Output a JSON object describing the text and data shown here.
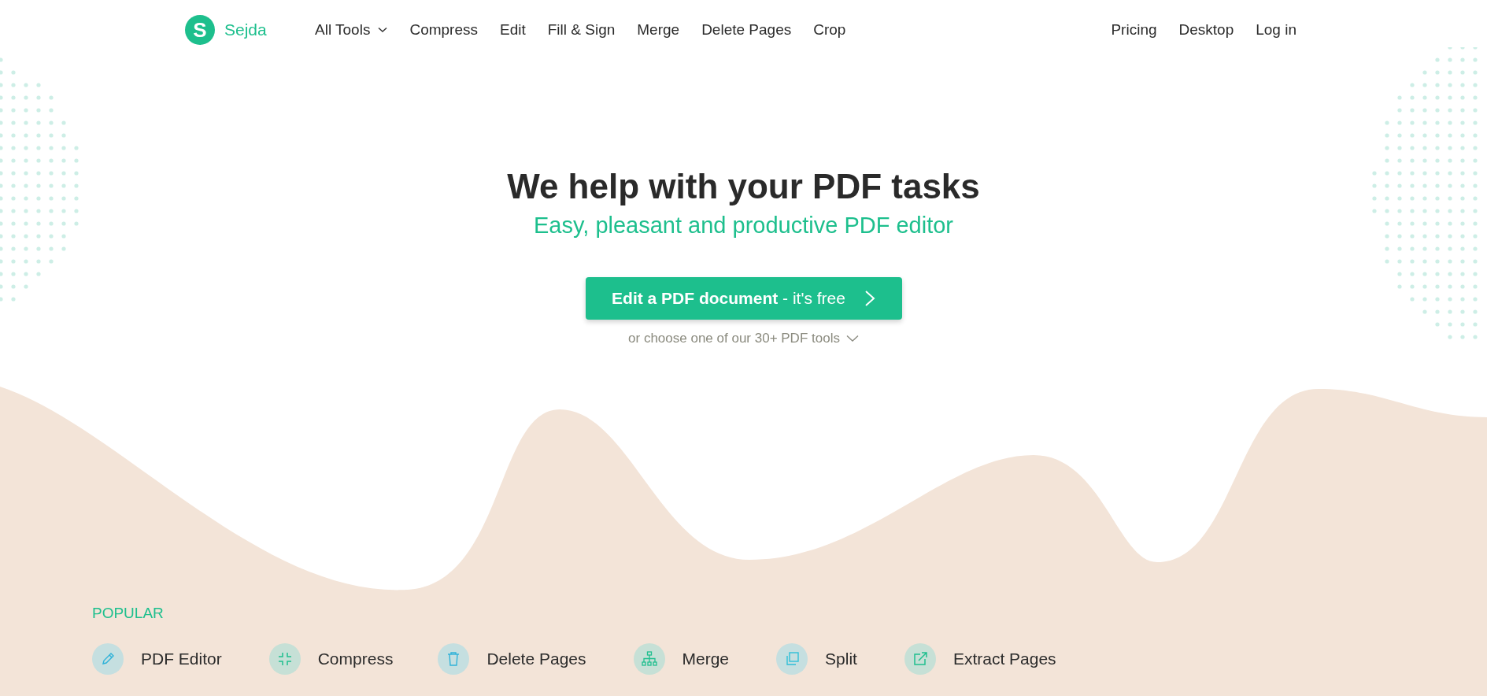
{
  "brand": {
    "logo_letter": "S",
    "name": "Sejda"
  },
  "nav": [
    {
      "label": "All Tools",
      "dropdown": true
    },
    {
      "label": "Compress",
      "dropdown": false
    },
    {
      "label": "Edit",
      "dropdown": false
    },
    {
      "label": "Fill & Sign",
      "dropdown": false
    },
    {
      "label": "Merge",
      "dropdown": false
    },
    {
      "label": "Delete Pages",
      "dropdown": false
    },
    {
      "label": "Crop",
      "dropdown": false
    }
  ],
  "nav_right": [
    "Pricing",
    "Desktop",
    "Log in"
  ],
  "hero": {
    "title": "We help with your PDF tasks",
    "subtitle": "Easy, pleasant and productive PDF editor",
    "cta": "**Edit a PDF document** - it's free",
    "more": "or choose one of our 30+ PDF tools"
  },
  "popular": {
    "heading": "POPULAR",
    "tools": [
      {
        "label": "PDF Editor",
        "kind": "pencil"
      },
      {
        "label": "Compress",
        "kind": "compress"
      },
      {
        "label": "Delete Pages",
        "kind": "trash"
      },
      {
        "label": "Merge",
        "kind": "merge"
      },
      {
        "label": "Split",
        "kind": "split"
      },
      {
        "label": "Extract Pages",
        "kind": "extract"
      }
    ]
  }
}
